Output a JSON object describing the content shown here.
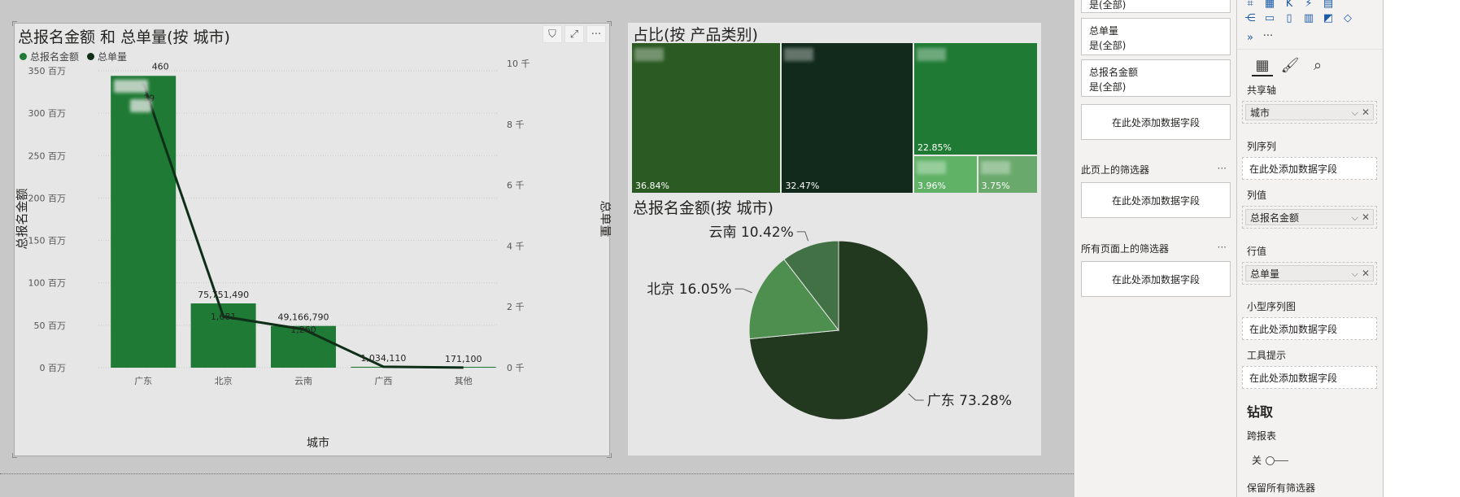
{
  "combo_chart": {
    "title": "总报名金额 和 总单量(按 城市)",
    "legend": [
      {
        "label": "总报名金额",
        "color": "#1e7a34"
      },
      {
        "label": "总单量",
        "color": "#0f2e17"
      }
    ],
    "header_icons": [
      "filter-icon",
      "focus-mode-icon",
      "more-options-icon"
    ],
    "header_glyphs": {
      "filter": "⛉",
      "focus": "⤢",
      "more": "···"
    }
  },
  "chart_data": [
    {
      "type": "bar",
      "title": "总报名金额 和 总单量(按 城市)",
      "categories": [
        "广东",
        "北京",
        "云南",
        "广西",
        "其他"
      ],
      "xlabel": "城市",
      "ylabel": "总报名金额",
      "y2label": "总单量",
      "ylim": [
        0,
        350000000
      ],
      "y2lim": [
        0,
        10000
      ],
      "y_ticks": [
        "0 百万",
        "50 百万",
        "100 百万",
        "150 百万",
        "200 百万",
        "250 百万",
        "300 百万",
        "350 百万"
      ],
      "y2_ticks": [
        "0 千",
        "2 千",
        "4 千",
        "6 千",
        "8 千",
        "10 千"
      ],
      "grid": true,
      "legend_position": "top-left",
      "series": [
        {
          "name": "总报名金额",
          "type": "bar",
          "color": "#1e7a34",
          "values": [
            344000000,
            75751490,
            49166790,
            1034110,
            171100
          ],
          "labels": [
            "",
            "75,751,490",
            "49,166,790",
            "1,034,110",
            "171,100"
          ]
        },
        {
          "name": "总单量",
          "type": "line",
          "color": "#0f2e17",
          "values": [
            9339,
            1681,
            1260,
            30,
            5
          ],
          "labels": [
            "",
            "1,681",
            "1,260",
            "",
            ""
          ]
        }
      ],
      "partial_labels": {
        "top_bar_value": "460",
        "top_line_value": "39"
      }
    },
    {
      "type": "treemap",
      "title": "占比(按 产品类别)",
      "values": [
        36.84,
        32.47,
        22.85,
        3.96,
        3.75
      ],
      "labels": [
        "36.84%",
        "32.47%",
        "22.85%",
        "3.96%",
        "3.75%"
      ],
      "colors": [
        "#2b5a22",
        "#112a1b",
        "#1f7a34",
        "#5fb266",
        "#6aa96c"
      ]
    },
    {
      "type": "pie",
      "title": "总报名金额(按 城市)",
      "slices": [
        {
          "name": "广东",
          "value": 73.28,
          "label": "广东 73.28%",
          "color": "#22381f"
        },
        {
          "name": "北京",
          "value": 16.05,
          "label": "北京 16.05%",
          "color": "#4e8f50"
        },
        {
          "name": "云南",
          "value": 10.42,
          "label": "云南 10.42%",
          "color": "#427145"
        }
      ]
    }
  ],
  "filter_pane": {
    "top_card_partial": "是(全部)",
    "cards": [
      {
        "field": "总单量",
        "value": "是(全部)"
      },
      {
        "field": "总报名金额",
        "value": "是(全部)"
      }
    ],
    "add_field_text": "在此处添加数据字段",
    "page_filters_heading": "此页上的筛选器",
    "all_pages_heading": "所有页面上的筛选器",
    "more": "···"
  },
  "viz_pane": {
    "tab_icons": [
      "fields-tab-icon",
      "format-tab-icon",
      "analytics-tab-icon"
    ],
    "tab_glyphs": {
      "fields": "▦",
      "format": "🖌",
      "analytics": "⌕"
    },
    "more_visuals": "···",
    "wells": [
      {
        "label": "共享轴",
        "field": "城市"
      },
      {
        "label": "列序列",
        "field": ""
      },
      {
        "label": "列值",
        "field": "总报名金额"
      },
      {
        "label": "行值",
        "field": "总单量"
      },
      {
        "label": "小型序列图",
        "field": ""
      },
      {
        "label": "工具提示",
        "field": ""
      }
    ],
    "add_field_text": "在此处添加数据字段",
    "pill_chevron": "⌵",
    "pill_remove": "✕",
    "drill_heading": "钻取",
    "cross_report_label": "跨报表",
    "toggle_off_label": "关",
    "keep_all_filters": "保留所有筛选器"
  }
}
